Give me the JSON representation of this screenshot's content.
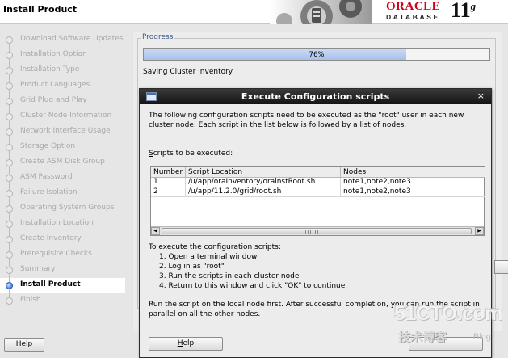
{
  "window": {
    "title": "Install Product",
    "brand": {
      "oracle": "ORACLE",
      "product": "DATABASE",
      "version": "11",
      "version_suffix": "g"
    }
  },
  "sidebar": {
    "steps": [
      {
        "label": "Download Software Updates",
        "state": "done"
      },
      {
        "label": "Installation Option",
        "state": "done"
      },
      {
        "label": "Installation Type",
        "state": "done"
      },
      {
        "label": "Product Languages",
        "state": "done"
      },
      {
        "label": "Grid Plug and Play",
        "state": "done"
      },
      {
        "label": "Cluster Node Information",
        "state": "done"
      },
      {
        "label": "Network Interface Usage",
        "state": "done"
      },
      {
        "label": "Storage Option",
        "state": "done"
      },
      {
        "label": "Create ASM Disk Group",
        "state": "done"
      },
      {
        "label": "ASM Password",
        "state": "done"
      },
      {
        "label": "Failure Isolation",
        "state": "done"
      },
      {
        "label": "Operating System Groups",
        "state": "done"
      },
      {
        "label": "Installation Location",
        "state": "done"
      },
      {
        "label": "Create Inventory",
        "state": "done"
      },
      {
        "label": "Prerequisite Checks",
        "state": "done"
      },
      {
        "label": "Summary",
        "state": "done"
      },
      {
        "label": "Install Product",
        "state": "active"
      },
      {
        "label": "Finish",
        "state": "pending"
      }
    ]
  },
  "progress": {
    "legend": "Progress",
    "percent": 76,
    "percent_label": "76%",
    "status": "Saving Cluster Inventory"
  },
  "footer": {
    "help_label": "Help",
    "help_mnemonic": "H",
    "help_rest": "elp"
  },
  "dialog": {
    "title": "Execute Configuration scripts",
    "intro": "The following configuration scripts need to be executed as the \"root\" user in each new cluster node. Each script in the list below is followed by a list of nodes.",
    "scripts_label_mnemonic": "S",
    "scripts_label_rest": "cripts to be executed:",
    "table": {
      "columns": [
        "Number",
        "Script Location",
        "Nodes"
      ],
      "rows": [
        {
          "number": "1",
          "location": "/u/app/oraInventory/orainstRoot.sh",
          "nodes": "note1,note2,note3"
        },
        {
          "number": "2",
          "location": "/u/app/11.2.0/grid/root.sh",
          "nodes": "note1,note2,note3"
        }
      ]
    },
    "instructions_title": "To execute the configuration scripts:",
    "instructions": [
      "1. Open a terminal window",
      "2. Log in as \"root\"",
      "3. Run the scripts in each cluster node",
      "4. Return to this window and click \"OK\" to continue"
    ],
    "note": "Run the script on the local node first. After successful completion, you can run the script in parallel on all the other nodes.",
    "help_mnemonic": "H",
    "help_rest": "elp",
    "close_glyph": "×"
  },
  "watermark": {
    "main": "51CTO.com",
    "sub": "技术博客",
    "blog": "Blog"
  },
  "colors": {
    "oracle_red": "#d0001b",
    "progress_fill": "#a7c1ea",
    "titlebar": "#141414"
  }
}
